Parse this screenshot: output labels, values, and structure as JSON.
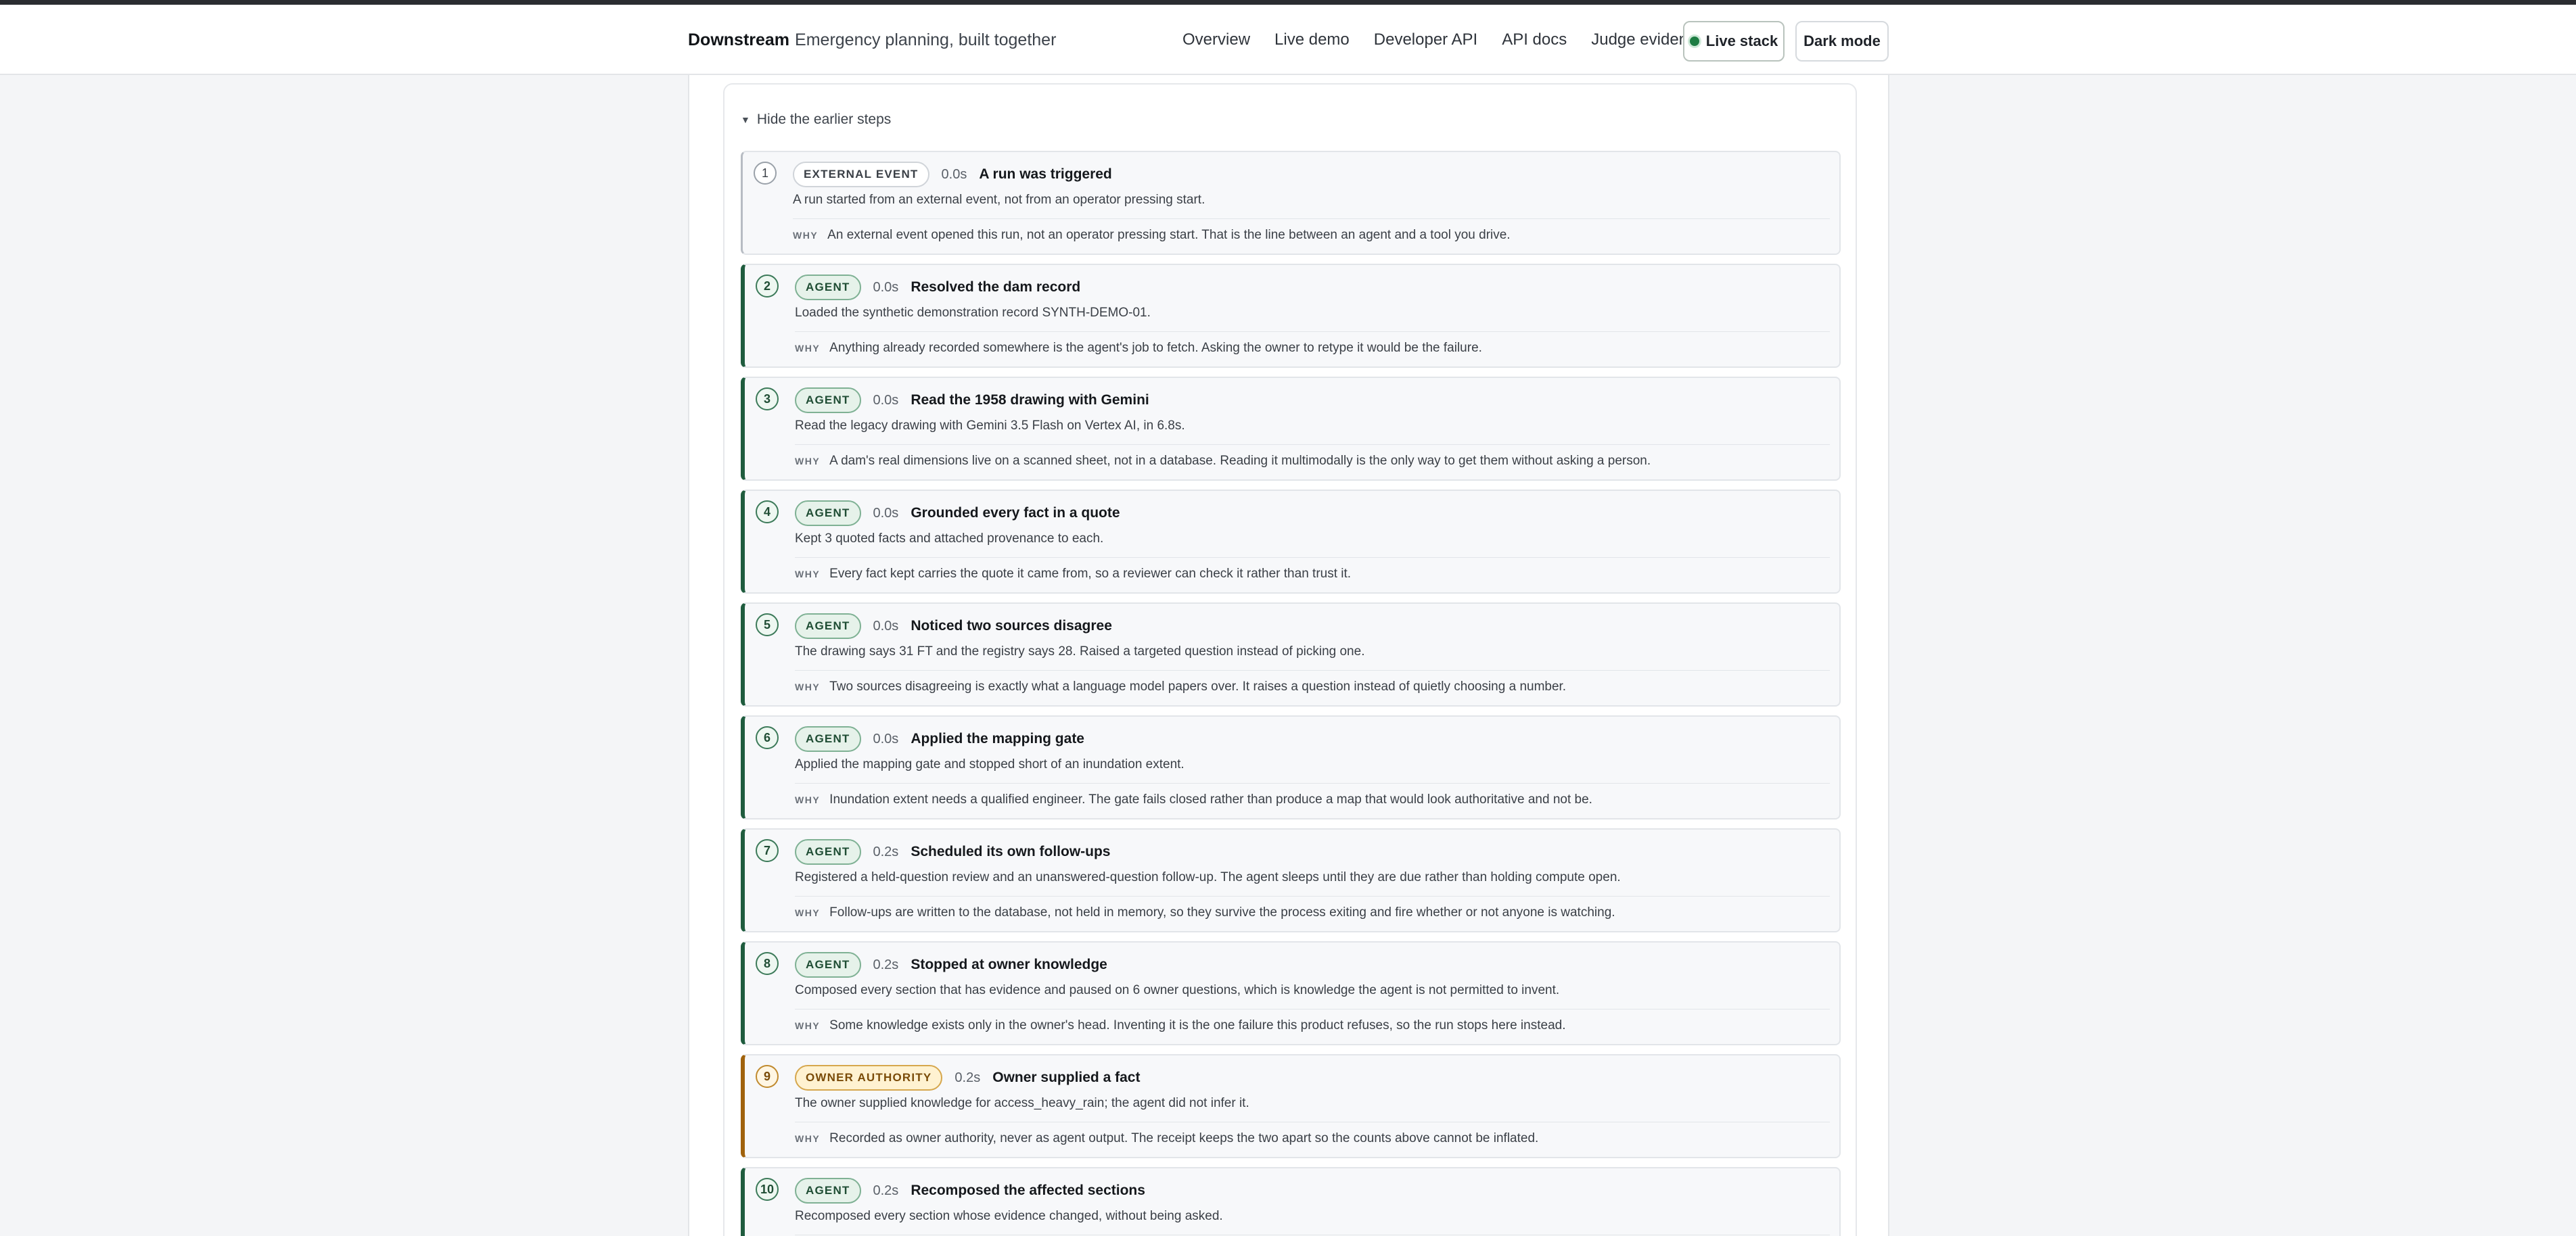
{
  "header": {
    "brand": "Downstream",
    "tagline": "Emergency planning, built together",
    "nav": [
      "Overview",
      "Live demo",
      "Developer API",
      "API docs",
      "Judge evidence"
    ],
    "live_button": "Live stack",
    "dark_button": "Dark mode"
  },
  "panel": {
    "toggle_label": "Hide the earlier steps"
  },
  "why_label": "WHY",
  "steps": [
    {
      "n": "1",
      "kind": "external",
      "badge": "EXTERNAL EVENT",
      "time": "0.0s",
      "title": "A run was triggered",
      "summary": "A run started from an external event, not from an operator pressing start.",
      "why": "An external event opened this run, not an operator pressing start. That is the line between an agent and a tool you drive."
    },
    {
      "n": "2",
      "kind": "agent",
      "badge": "AGENT",
      "time": "0.0s",
      "title": "Resolved the dam record",
      "summary": "Loaded the synthetic demonstration record SYNTH-DEMO-01.",
      "why": "Anything already recorded somewhere is the agent's job to fetch. Asking the owner to retype it would be the failure."
    },
    {
      "n": "3",
      "kind": "agent",
      "badge": "AGENT",
      "time": "0.0s",
      "title": "Read the 1958 drawing with Gemini",
      "summary": "Read the legacy drawing with Gemini 3.5 Flash on Vertex AI, in 6.8s.",
      "why": "A dam's real dimensions live on a scanned sheet, not in a database. Reading it multimodally is the only way to get them without asking a person."
    },
    {
      "n": "4",
      "kind": "agent",
      "badge": "AGENT",
      "time": "0.0s",
      "title": "Grounded every fact in a quote",
      "summary": "Kept 3 quoted facts and attached provenance to each.",
      "why": "Every fact kept carries the quote it came from, so a reviewer can check it rather than trust it."
    },
    {
      "n": "5",
      "kind": "agent",
      "badge": "AGENT",
      "time": "0.0s",
      "title": "Noticed two sources disagree",
      "summary": "The drawing says 31 FT and the registry says 28. Raised a targeted question instead of picking one.",
      "why": "Two sources disagreeing is exactly what a language model papers over. It raises a question instead of quietly choosing a number."
    },
    {
      "n": "6",
      "kind": "agent",
      "badge": "AGENT",
      "time": "0.0s",
      "title": "Applied the mapping gate",
      "summary": "Applied the mapping gate and stopped short of an inundation extent.",
      "why": "Inundation extent needs a qualified engineer. The gate fails closed rather than produce a map that would look authoritative and not be."
    },
    {
      "n": "7",
      "kind": "agent",
      "badge": "AGENT",
      "time": "0.2s",
      "title": "Scheduled its own follow-ups",
      "summary": "Registered a held-question review and an unanswered-question follow-up. The agent sleeps until they are due rather than holding compute open.",
      "why": "Follow-ups are written to the database, not held in memory, so they survive the process exiting and fire whether or not anyone is watching."
    },
    {
      "n": "8",
      "kind": "agent",
      "badge": "AGENT",
      "time": "0.2s",
      "title": "Stopped at owner knowledge",
      "summary": "Composed every section that has evidence and paused on 6 owner questions, which is knowledge the agent is not permitted to invent.",
      "why": "Some knowledge exists only in the owner's head. Inventing it is the one failure this product refuses, so the run stops here instead."
    },
    {
      "n": "9",
      "kind": "owner",
      "badge": "OWNER AUTHORITY",
      "time": "0.2s",
      "title": "Owner supplied a fact",
      "summary": "The owner supplied knowledge for access_heavy_rain; the agent did not infer it.",
      "why": "Recorded as owner authority, never as agent output. The receipt keeps the two apart so the counts above cannot be inflated."
    },
    {
      "n": "10",
      "kind": "agent",
      "badge": "AGENT",
      "time": "0.2s",
      "title": "Recomposed the affected sections",
      "summary": "Recomposed every section whose evidence changed, without being asked.",
      "why": ""
    }
  ]
}
